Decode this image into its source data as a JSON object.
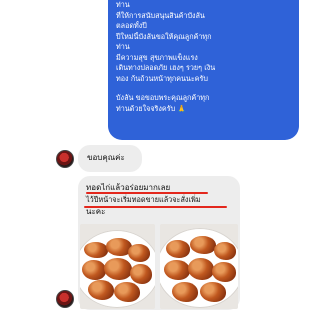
{
  "outgoing_message": {
    "lines": [
      "ท่าน",
      "ที่ให้การสนับสนุนสินค้าบังลัน",
      "ตลอดทั้งปี",
      "ปีใหม่นี้บังลันขอให้คุณลูกค้าทุก",
      "ท่าน",
      "มีความสุข สุขภาพแข็งแรง",
      "เดินทางปลอดภัย เฮงๆ รวยๆ เงิน",
      "ทอง ก้นถ้วนหน้าทุกคนนะครับ"
    ],
    "closing_lines": [
      "บังลัน ขอขอบพระคุณลูกค้าทุก",
      "ท่านด้วยใจจริงครับ 🙏"
    ]
  },
  "reply_1": {
    "text": "ขอบคุณค่ะ"
  },
  "reply_2": {
    "line1": "ทอดไก่แล้วอร่อยมากเลย",
    "line2": "ไว้ปีหน้าจะเริ่มทอดขายแล้วจะสั่งเพิ่ม",
    "line3": "นะคะ"
  },
  "colors": {
    "outgoing_bubble": "#2f62d8",
    "incoming_bubble": "#ededed",
    "underline": "#e3271d"
  }
}
